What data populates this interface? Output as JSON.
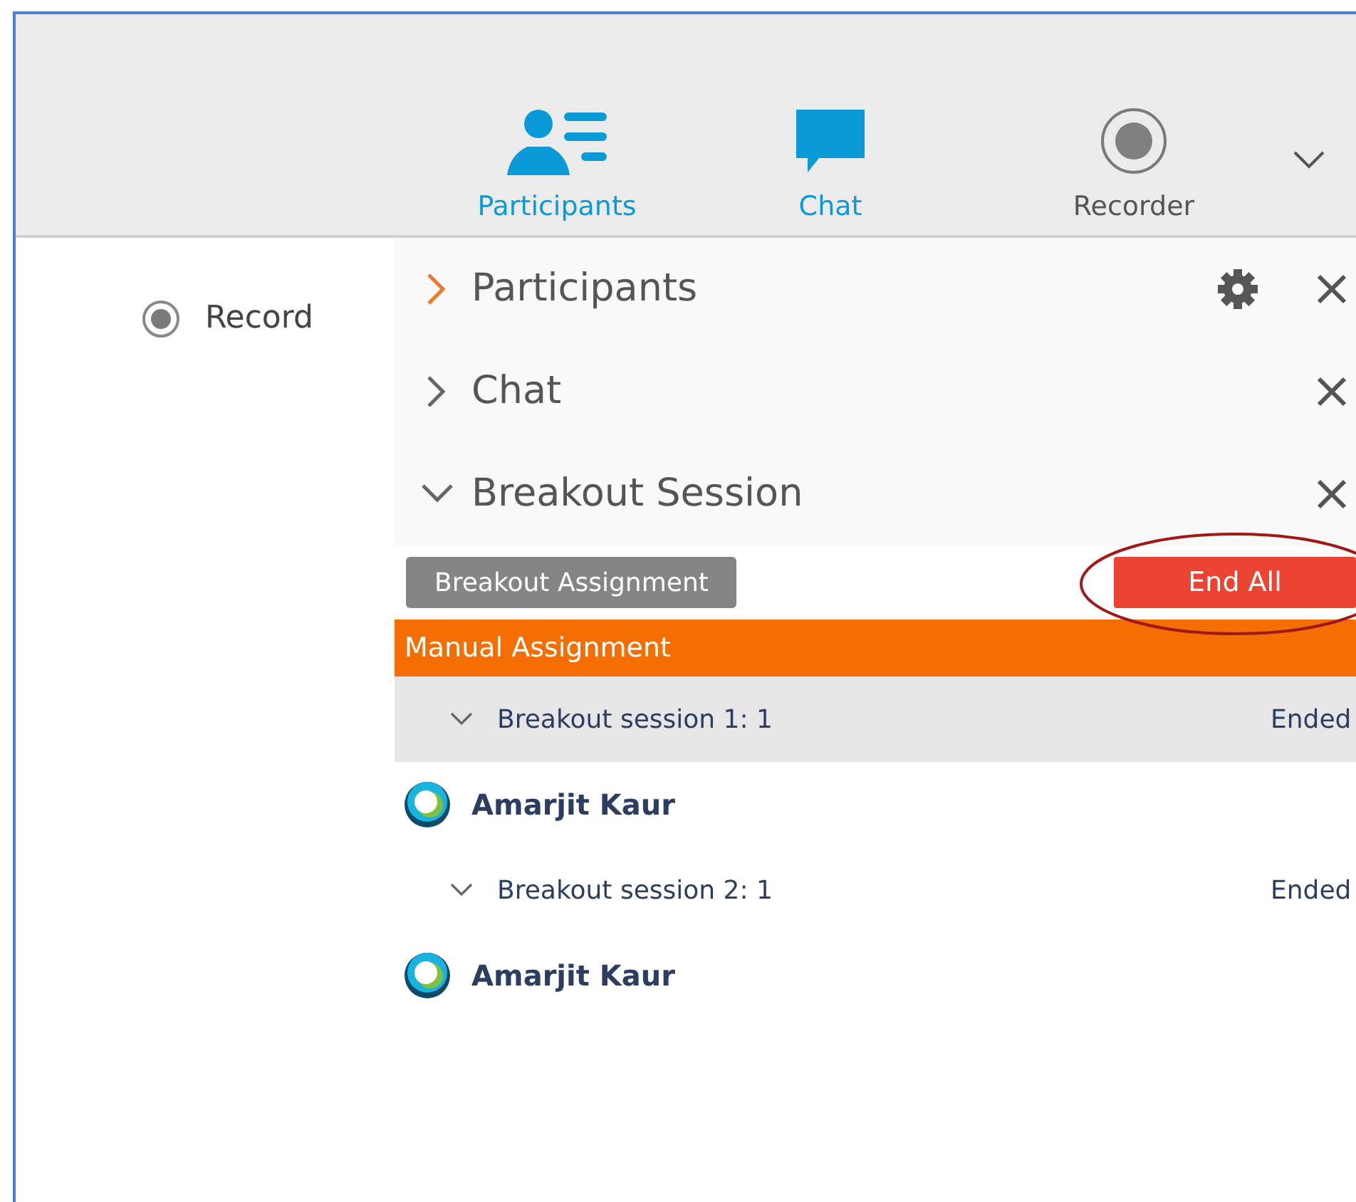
{
  "toolbar": {
    "tabs": [
      {
        "label": "Participants",
        "kind": "participants",
        "active": true
      },
      {
        "label": "Chat",
        "kind": "chat",
        "active": true
      },
      {
        "label": "Recorder",
        "kind": "recorder",
        "active": false
      }
    ]
  },
  "record": {
    "label": "Record",
    "selected": true
  },
  "panels": [
    {
      "title": "Participants",
      "expanded": false,
      "focused": true,
      "settings": true
    },
    {
      "title": "Chat",
      "expanded": false,
      "focused": false,
      "settings": false
    },
    {
      "title": "Breakout Session",
      "expanded": true,
      "focused": false,
      "settings": false
    }
  ],
  "breakout": {
    "assignment_button": "Breakout Assignment",
    "end_button": "End All",
    "mode": "Manual Assignment",
    "sessions": [
      {
        "name": "Breakout session 1: 1",
        "status": "Ended",
        "expanded": true,
        "selected": true,
        "members": [
          "Amarjit Kaur"
        ]
      },
      {
        "name": "Breakout session 2: 1",
        "status": "Ended",
        "expanded": true,
        "selected": false,
        "members": [
          "Amarjit Kaur"
        ]
      }
    ]
  }
}
